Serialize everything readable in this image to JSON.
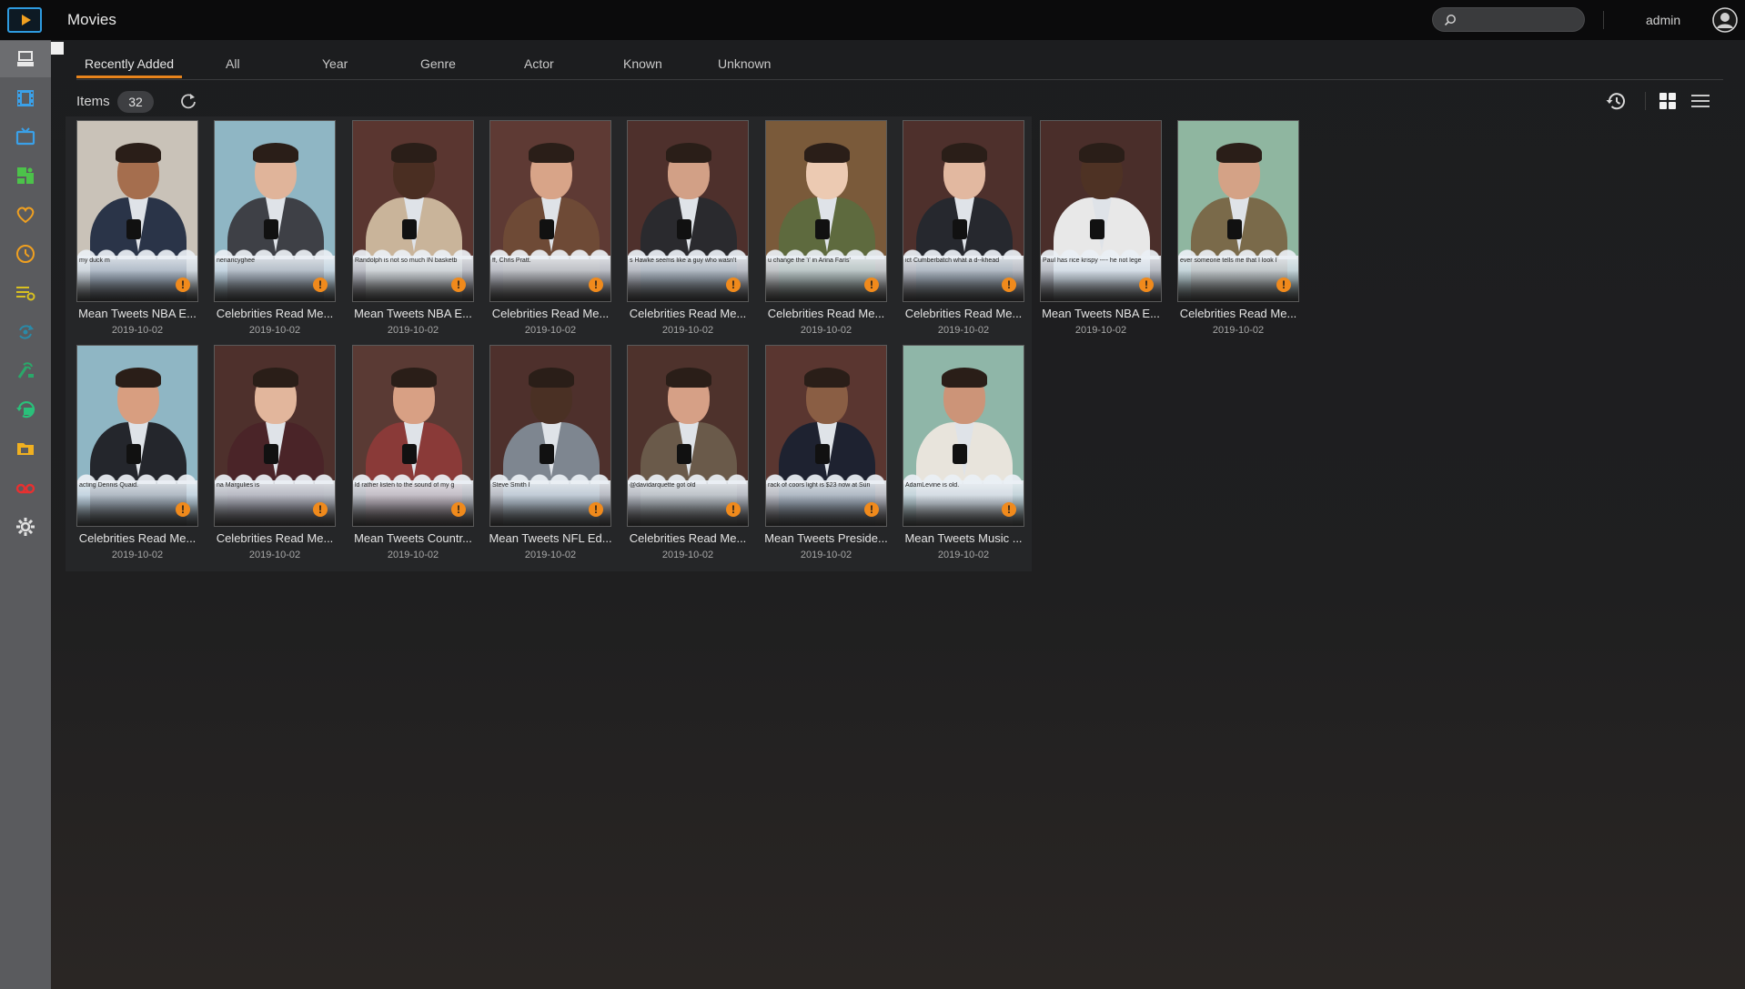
{
  "header": {
    "title": "Movies",
    "search": {
      "placeholder": "",
      "value": ""
    },
    "user": "admin"
  },
  "sidebar": {
    "items": [
      {
        "name": "sidebar-item-dashboard",
        "icon": "dashboard-icon",
        "color": "#e8e8e8",
        "active": true
      },
      {
        "name": "sidebar-item-movies",
        "icon": "film-icon",
        "color": "#3aa0e8"
      },
      {
        "name": "sidebar-item-tv",
        "icon": "tv-icon",
        "color": "#3aa0e8"
      },
      {
        "name": "sidebar-item-music-video",
        "icon": "music-video-icon",
        "color": "#4cc24a"
      },
      {
        "name": "sidebar-item-favorites",
        "icon": "heart-icon",
        "color": "#f0a020"
      },
      {
        "name": "sidebar-item-recent",
        "icon": "clock-icon",
        "color": "#f0a020"
      },
      {
        "name": "sidebar-item-playlists",
        "icon": "playlist-icon",
        "color": "#d8c020"
      },
      {
        "name": "sidebar-item-sync",
        "icon": "sync-icon",
        "color": "#2a8aa8"
      },
      {
        "name": "sidebar-item-tuner",
        "icon": "tuner-icon",
        "color": "#2aa86a"
      },
      {
        "name": "sidebar-item-schedule",
        "icon": "schedule-icon",
        "color": "#2ac07a"
      },
      {
        "name": "sidebar-item-folders",
        "icon": "folder-icon",
        "color": "#f0b020"
      },
      {
        "name": "sidebar-item-recordings",
        "icon": "record-icon",
        "color": "#e83030"
      },
      {
        "name": "sidebar-item-settings",
        "icon": "gear-icon",
        "color": "#e0e0e0"
      }
    ]
  },
  "tabs": [
    {
      "label": "Recently Added",
      "active": true
    },
    {
      "label": "All"
    },
    {
      "label": "Year"
    },
    {
      "label": "Genre"
    },
    {
      "label": "Actor"
    },
    {
      "label": "Known"
    },
    {
      "label": "Unknown"
    }
  ],
  "toolbar": {
    "items_label": "Items",
    "items_count": "32"
  },
  "colors": {
    "accent": "#e8841c",
    "warning": "#f08a1c",
    "topbar": "#0b0b0c",
    "sidebar": "#5a5b5e"
  },
  "movies": [
    {
      "title": "Mean Tweets NBA E...",
      "date": "2019-10-02",
      "tweet": "my duck m",
      "wall": "#c9c2b8",
      "skin": "#a56e4e",
      "suit": "#2a3448"
    },
    {
      "title": "Celebrities Read Me...",
      "date": "2019-10-02",
      "tweet": "nenancyghee",
      "wall": "#8fb6c4",
      "skin": "#e0b49a",
      "suit": "#3e4046"
    },
    {
      "title": "Mean Tweets NBA E...",
      "date": "2019-10-02",
      "tweet": "Randolph is not so much IN basketb",
      "wall": "#5a3630",
      "skin": "#4a2e22",
      "suit": "#c9b49a"
    },
    {
      "title": "Celebrities Read Me...",
      "date": "2019-10-02",
      "tweet": "ff, Chris Pratt.",
      "wall": "#5e3a34",
      "skin": "#d8a488",
      "suit": "#6e4a36"
    },
    {
      "title": "Celebrities Read Me...",
      "date": "2019-10-02",
      "tweet": "s Hawke seems like a guy who wasn't",
      "wall": "#4e302c",
      "skin": "#d2a086",
      "suit": "#2a2a2e"
    },
    {
      "title": "Celebrities Read Me...",
      "date": "2019-10-02",
      "tweet": "u change the 'i' in Anna Faris'",
      "wall": "#7a5a3a",
      "skin": "#eccab2",
      "suit": "#5e6a3e"
    },
    {
      "title": "Celebrities Read Me...",
      "date": "2019-10-02",
      "tweet": "ict Cumberbatch what a d--khead",
      "wall": "#4e302c",
      "skin": "#e2b8a0",
      "suit": "#26282e"
    },
    {
      "title": "Mean Tweets NBA E...",
      "date": "2019-10-02",
      "tweet": "Paul has rice krispy ---- he not lege",
      "wall": "#4a2e2a",
      "skin": "#4e3224",
      "suit": "#e8e8e8"
    },
    {
      "title": "Celebrities Read Me...",
      "date": "2019-10-02",
      "tweet": "ever someone tells me that I look l",
      "wall": "#8fb6a0",
      "skin": "#d4a286",
      "suit": "#7a6a4a"
    },
    {
      "title": "Celebrities Read Me...",
      "date": "2019-10-02",
      "tweet": "acting Dennis Quaid.",
      "wall": "#8fb6c4",
      "skin": "#d89e80",
      "suit": "#24262c"
    },
    {
      "title": "Celebrities Read Me...",
      "date": "2019-10-02",
      "tweet": "na Margulies is",
      "wall": "#4e302c",
      "skin": "#e2b69c",
      "suit": "#4a2428"
    },
    {
      "title": "Mean Tweets Countr...",
      "date": "2019-10-02",
      "tweet": "ld rather listen to the sound of my g",
      "wall": "#5a3a34",
      "skin": "#d8a084",
      "suit": "#8a3a38"
    },
    {
      "title": "Mean Tweets NFL Ed...",
      "date": "2019-10-02",
      "tweet": "Steve Smith I",
      "wall": "#4e302c",
      "skin": "#4a3024",
      "suit": "#7e8690"
    },
    {
      "title": "Celebrities Read Me...",
      "date": "2019-10-02",
      "tweet": "@davidarquette got old",
      "wall": "#4e322c",
      "skin": "#d6a086",
      "suit": "#6a5a4a"
    },
    {
      "title": "Mean Tweets Preside...",
      "date": "2019-10-02",
      "tweet": "rack of coors light is $23 now at Sun",
      "wall": "#5a3630",
      "skin": "#8a5e44",
      "suit": "#1e2230"
    },
    {
      "title": "Mean Tweets Music ...",
      "date": "2019-10-02",
      "tweet": "AdamLevine is old.",
      "wall": "#8fb6a8",
      "skin": "#cc9478",
      "suit": "#e8e4dc"
    }
  ]
}
